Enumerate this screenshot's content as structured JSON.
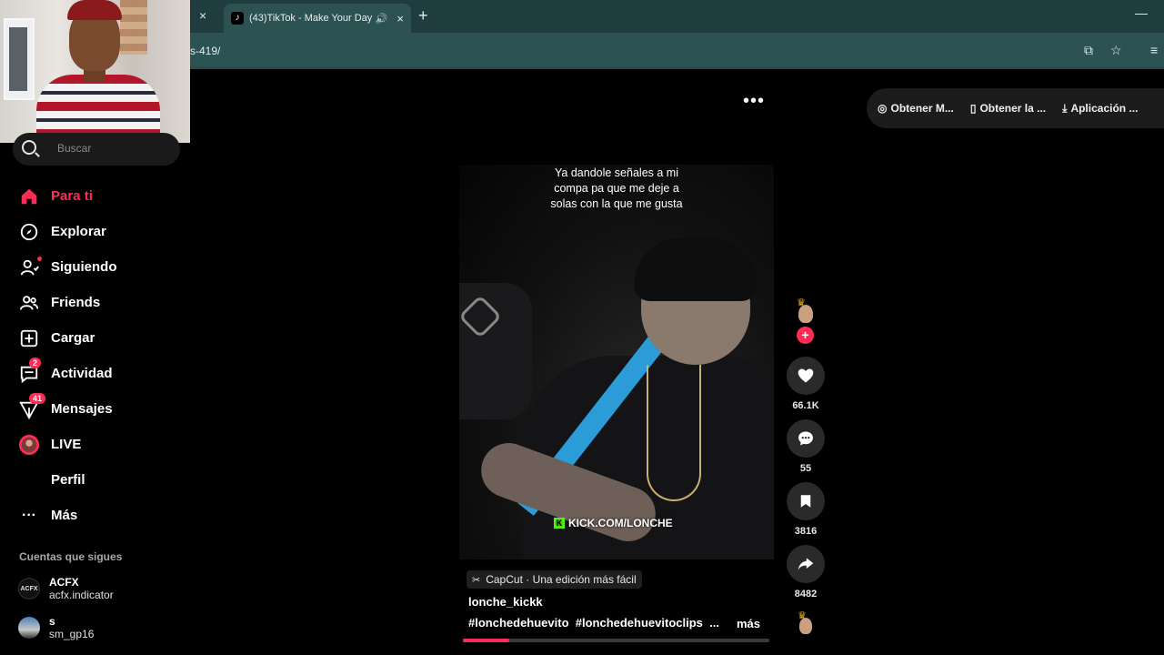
{
  "browser": {
    "tab_title": "(43)TikTok - Make Your Day",
    "tab_favicon": "♪",
    "url_fragment": "s-419/",
    "new_tab_symbol": "+",
    "close_symbol": "×",
    "minimize_symbol": "—"
  },
  "sidebar": {
    "search_placeholder": "Buscar",
    "nav": [
      {
        "label": "Para ti",
        "icon": "home-icon",
        "active": true
      },
      {
        "label": "Explorar",
        "icon": "compass-icon"
      },
      {
        "label": "Siguiendo",
        "icon": "following-icon",
        "dot": true
      },
      {
        "label": "Friends",
        "icon": "friends-icon"
      },
      {
        "label": "Cargar",
        "icon": "upload-icon"
      },
      {
        "label": "Actividad",
        "icon": "activity-icon",
        "badge": "2"
      },
      {
        "label": "Mensajes",
        "icon": "messages-icon",
        "badge": "41"
      },
      {
        "label": "LIVE",
        "icon": "live-icon"
      },
      {
        "label": "Perfil",
        "icon": "profile-icon"
      },
      {
        "label": "Más",
        "icon": "more-icon"
      }
    ],
    "following_title": "Cuentas que sigues",
    "following": [
      {
        "name": "ACFX",
        "handle": "acfx.indicator",
        "avatar_text": "ACFX"
      },
      {
        "name": "s",
        "handle": "sm_gp16",
        "avatar_text": ""
      }
    ]
  },
  "top_actions": {
    "more": "•••",
    "buttons": [
      {
        "label": "Obtener M...",
        "icon": "coin-icon"
      },
      {
        "label": "Obtener la ...",
        "icon": "phone-icon"
      },
      {
        "label": "Aplicación ...",
        "icon": "download-icon"
      }
    ]
  },
  "video": {
    "caption": "Ya dandole señales a mi compa pa que me deje a solas con la que me gusta",
    "watermark": "KICK.COM/LONCHE",
    "effect_label": "CapCut · Una edición más fácil",
    "author": "lonche_kickk",
    "hashtags": "#lonchedehuevito  #lonchedehuevitoclips  ...",
    "more_label": "más",
    "progress": 0.15
  },
  "actions": {
    "likes": "66.1K",
    "comments": "55",
    "saves": "3816",
    "shares": "8482",
    "follow_symbol": "+"
  },
  "colors": {
    "accent": "#fe2c55",
    "browser_chrome": "#1f3d3e",
    "address_bar": "#2c5253"
  }
}
